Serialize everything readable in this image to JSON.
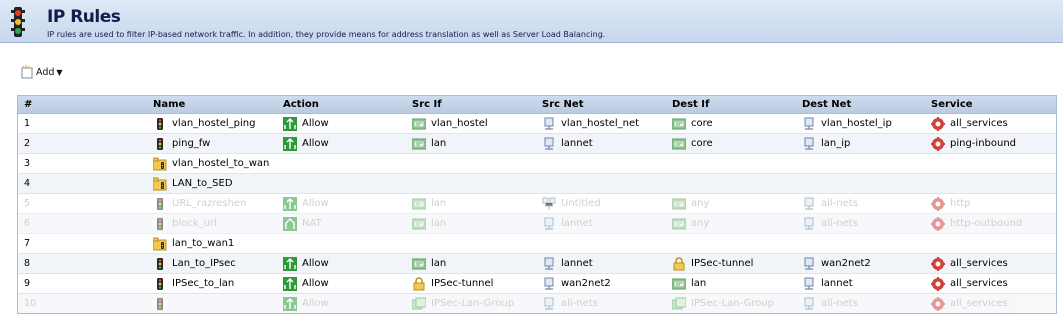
{
  "header": {
    "title": "IP Rules",
    "description": "IP rules are used to filter IP-based network traffic. In addition, they provide means for address translation as well as Server Load Balancing."
  },
  "toolbar": {
    "add_label": "Add"
  },
  "table": {
    "columns": [
      "#",
      "Name",
      "Action",
      "Src If",
      "Src Net",
      "Dest If",
      "Dest Net",
      "Service"
    ],
    "rows": [
      {
        "num": "1",
        "name": "vlan_hostel_ping",
        "action": "Allow",
        "src_if": "vlan_hostel",
        "src_net": "vlan_hostel_net",
        "dest_if": "core",
        "dest_net": "vlan_hostel_ip",
        "service": "all_services",
        "disabled": false,
        "folder": false
      },
      {
        "num": "2",
        "name": "ping_fw",
        "action": "Allow",
        "src_if": "lan",
        "src_net": "lannet",
        "dest_if": "core",
        "dest_net": "lan_ip",
        "service": "ping-inbound",
        "disabled": false,
        "folder": false
      },
      {
        "num": "3",
        "name": "vlan_hostel_to_wan",
        "action": "",
        "src_if": "",
        "src_net": "",
        "dest_if": "",
        "dest_net": "",
        "service": "",
        "disabled": false,
        "folder": true
      },
      {
        "num": "4",
        "name": "LAN_to_SED",
        "action": "",
        "src_if": "",
        "src_net": "",
        "dest_if": "",
        "dest_net": "",
        "service": "",
        "disabled": false,
        "folder": true
      },
      {
        "num": "5",
        "name": "URL_razreshen",
        "action": "Allow",
        "src_if": "lan",
        "src_net": "Untitled",
        "dest_if": "any",
        "dest_net": "all-nets",
        "service": "http",
        "disabled": true,
        "folder": false
      },
      {
        "num": "6",
        "name": "block_url",
        "action": "NAT",
        "src_if": "lan",
        "src_net": "lannet",
        "dest_if": "any",
        "dest_net": "all-nets",
        "service": "http-outbound",
        "disabled": true,
        "folder": false
      },
      {
        "num": "7",
        "name": "lan_to_wan1",
        "action": "",
        "src_if": "",
        "src_net": "",
        "dest_if": "",
        "dest_net": "",
        "service": "",
        "disabled": false,
        "folder": true
      },
      {
        "num": "8",
        "name": "Lan_to_IPsec",
        "action": "Allow",
        "src_if": "lan",
        "src_net": "lannet",
        "dest_if": "IPSec-tunnel",
        "dest_net": "wan2net2",
        "service": "all_services",
        "disabled": false,
        "folder": false
      },
      {
        "num": "9",
        "name": "IPSec_to_lan",
        "action": "Allow",
        "src_if": "IPSec-tunnel",
        "src_net": "wan2net2",
        "dest_if": "lan",
        "dest_net": "lannet",
        "service": "all_services",
        "disabled": false,
        "folder": false
      },
      {
        "num": "10",
        "name": "",
        "action": "Allow",
        "src_if": "IPSec-Lan-Group",
        "src_net": "all-nets",
        "dest_if": "IPSec-Lan-Group",
        "dest_net": "all-nets",
        "service": "all_services",
        "disabled": true,
        "folder": false
      }
    ]
  },
  "colors": {
    "header_bg": "#c7d7ee",
    "allow_green": "#2e9a3a",
    "disabled_text": "#a8a8a8",
    "grid_border": "#a9bcd9"
  }
}
